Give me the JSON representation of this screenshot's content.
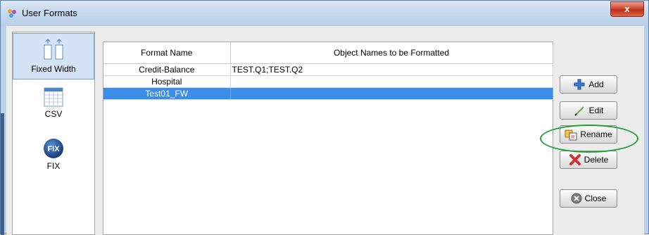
{
  "window": {
    "title": "User Formats",
    "close_label": "x"
  },
  "formats": [
    {
      "label": "Fixed Width",
      "icon": "fixed-width-icon",
      "selected": true
    },
    {
      "label": "CSV",
      "icon": "csv-icon",
      "selected": false
    },
    {
      "label": "FIX",
      "icon": "fix-icon",
      "selected": false
    }
  ],
  "table": {
    "headers": [
      "Format Name",
      "Object Names to be Formatted"
    ],
    "rows": [
      [
        "Credit-Balance",
        "TEST.Q1;TEST.Q2"
      ],
      [
        "Hospital",
        ""
      ],
      [
        "Test01_FW",
        ""
      ]
    ],
    "selected_row": 2
  },
  "buttons": {
    "add": "Add",
    "edit": "Edit",
    "rename": "Rename",
    "delete": "Delete",
    "close": "Close"
  },
  "colors": {
    "selection": "#3b8ee8",
    "annotation_ring": "#22a033"
  }
}
